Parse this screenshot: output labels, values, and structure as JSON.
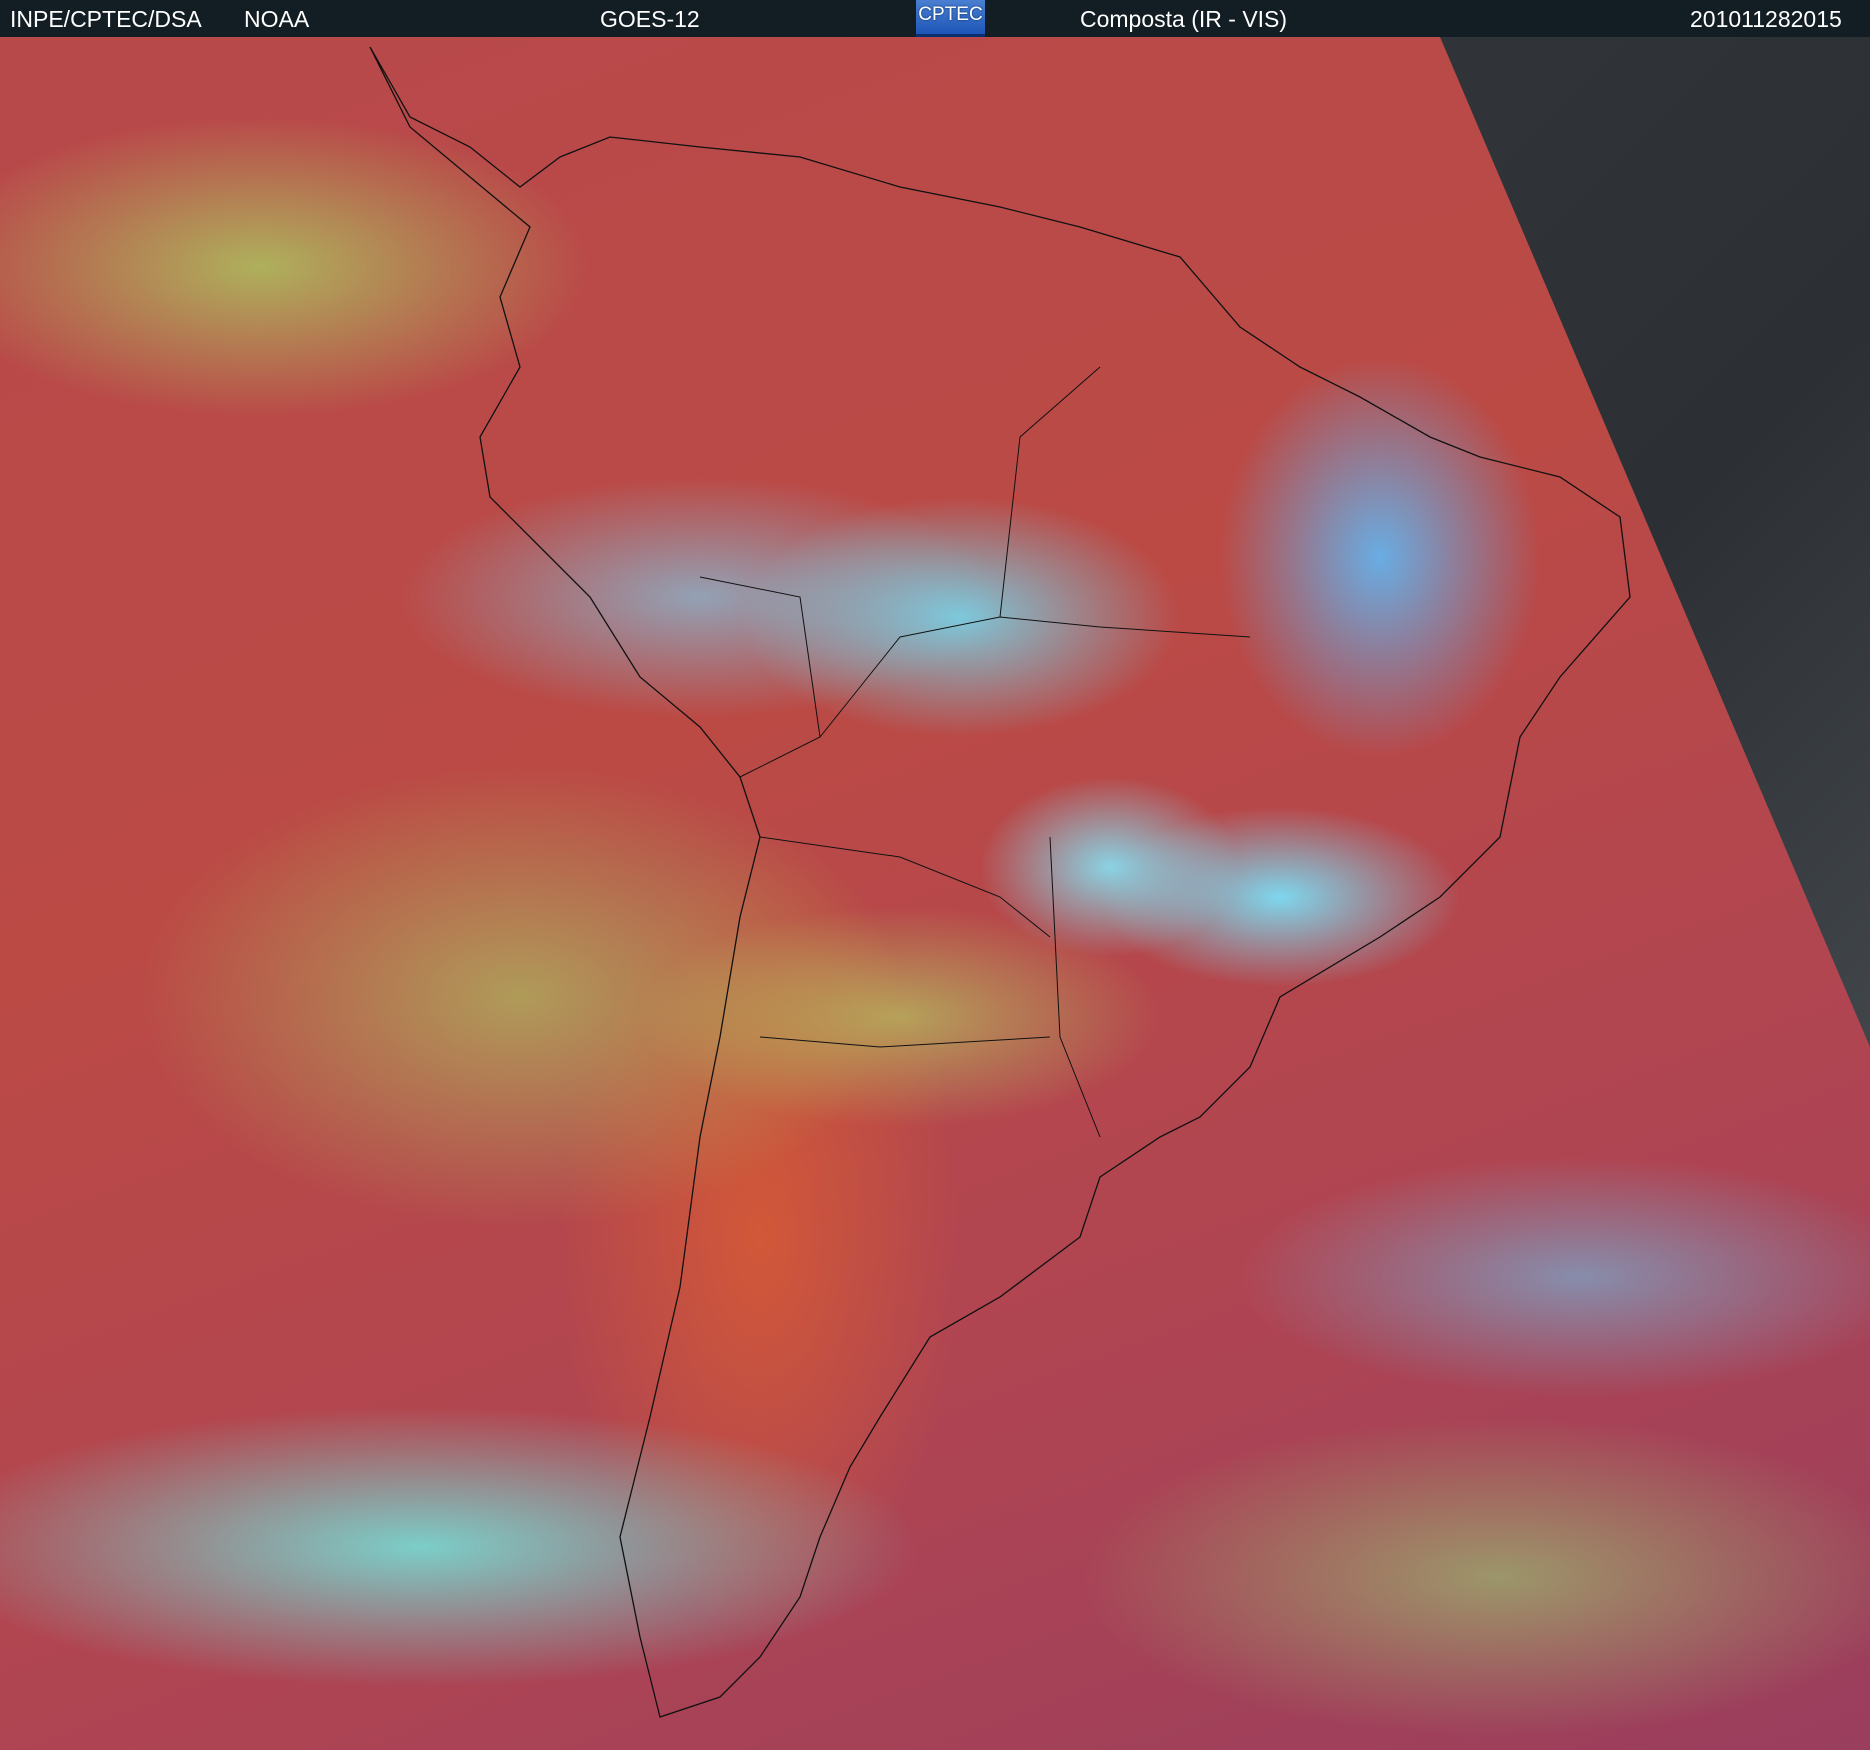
{
  "header": {
    "agency": "INPE/CPTEC/DSA",
    "source": "NOAA",
    "satellite": "GOES-12",
    "logo_text": "CPTEC",
    "product": "Composta (IR - VIS)",
    "timestamp": "201011282015"
  }
}
